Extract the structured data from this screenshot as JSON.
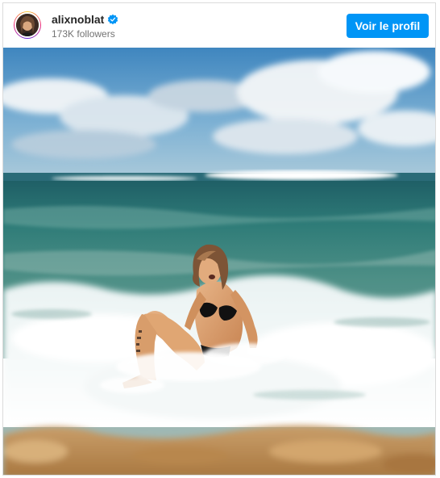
{
  "post": {
    "username": "alixnoblat",
    "followers": "173K followers",
    "profile_button_label": "Voir le profil",
    "verified_icon": "verified-badge-icon"
  },
  "photo": {
    "subject": "beach-photo"
  },
  "colors": {
    "accent": "#0095f6",
    "verified": "#0095f6",
    "username": "#262626",
    "secondary_text": "#737373",
    "border": "#dbdbdb"
  }
}
